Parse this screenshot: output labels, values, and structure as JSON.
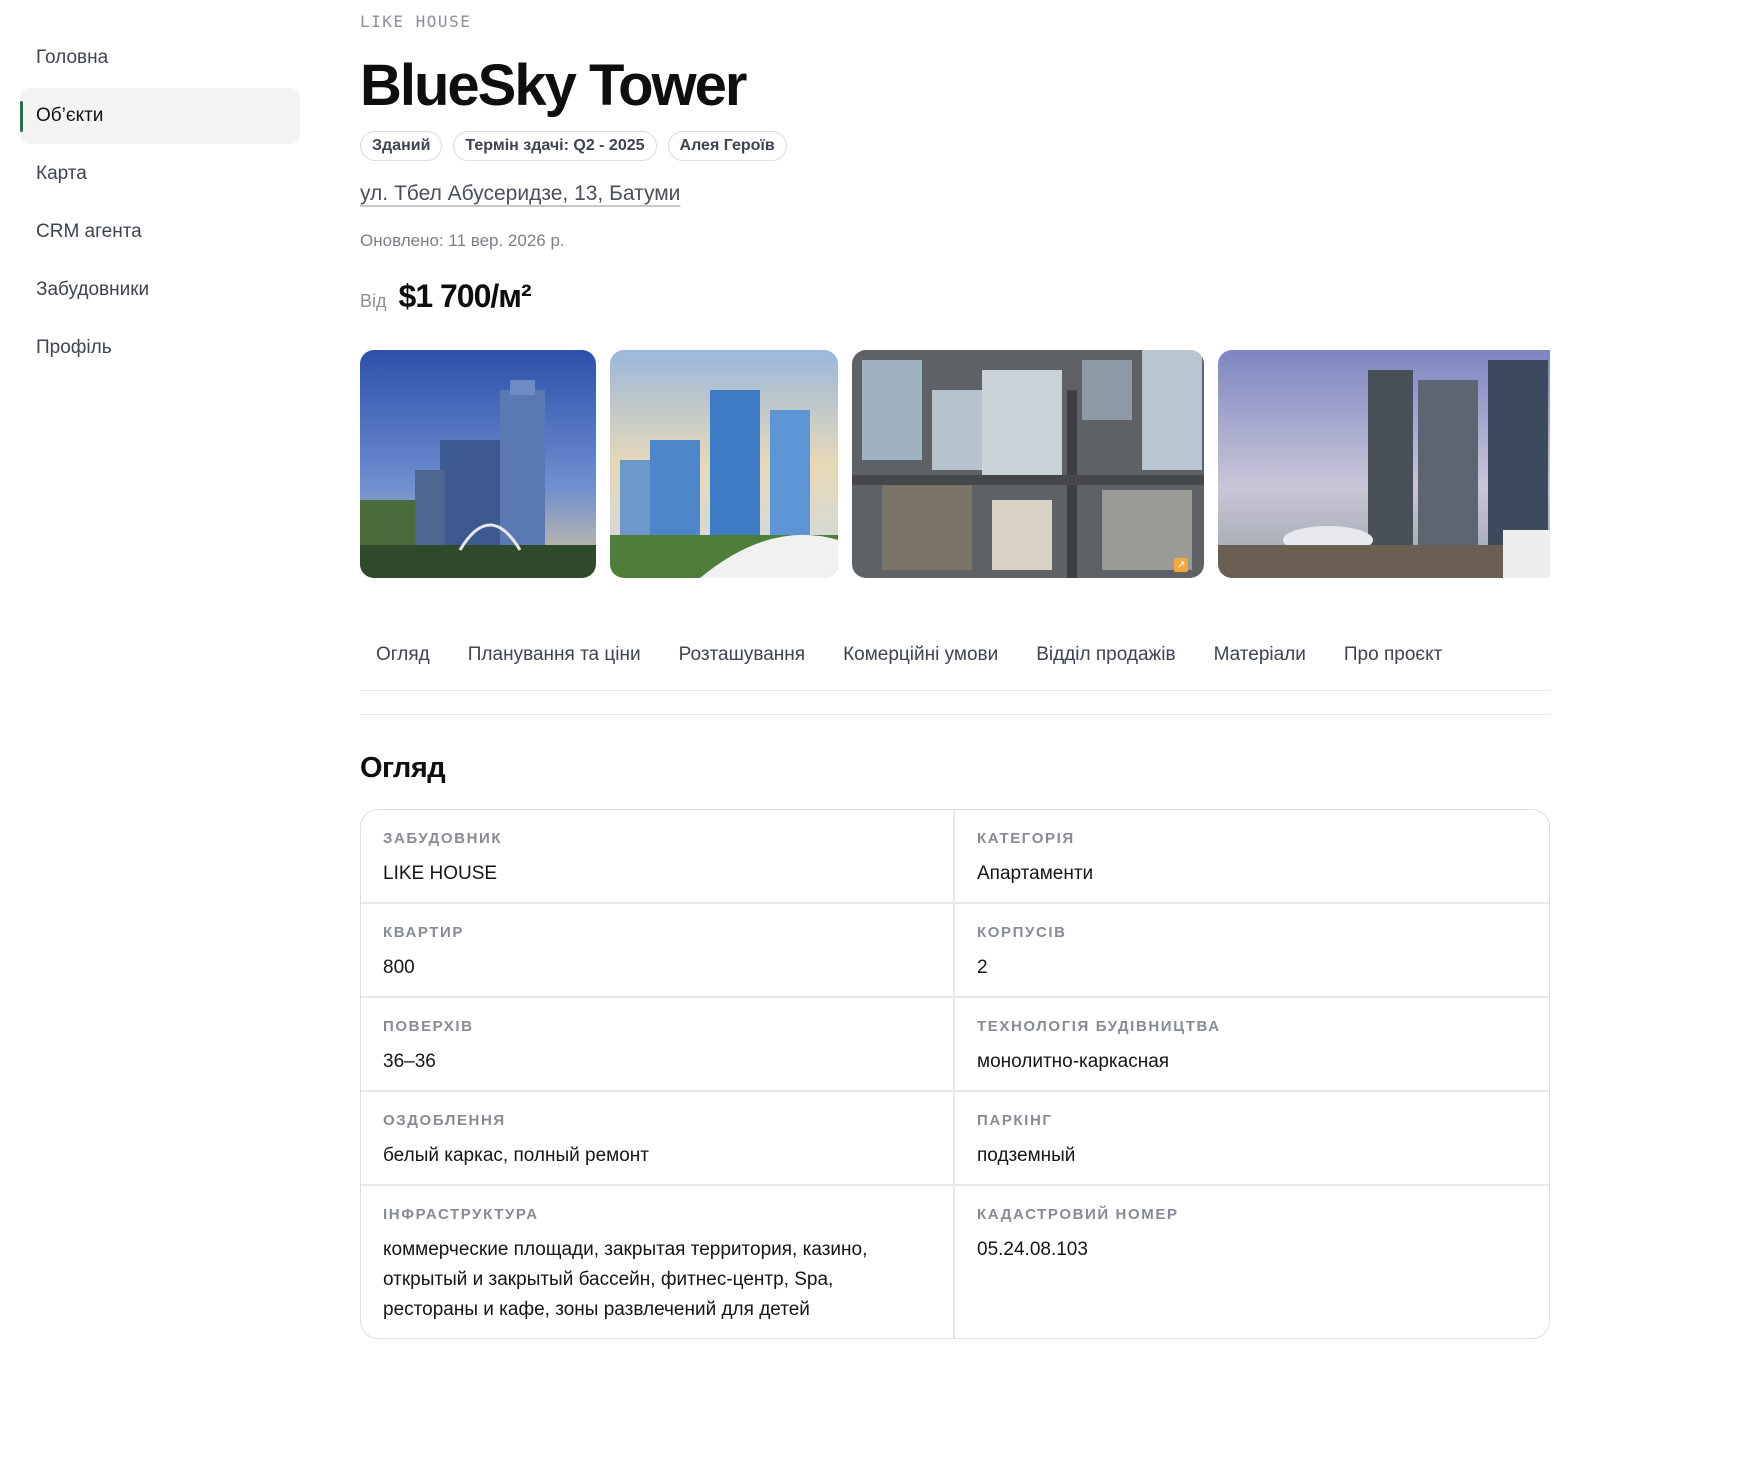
{
  "sidebar": {
    "items": [
      {
        "label": "Головна"
      },
      {
        "label": "Об’єкти",
        "active": true
      },
      {
        "label": "Карта"
      },
      {
        "label": "CRM агента"
      },
      {
        "label": "Забудовники"
      },
      {
        "label": "Профіль"
      }
    ]
  },
  "header": {
    "developer": "LIKE HOUSE",
    "title": "BlueSky Tower",
    "chips": [
      "Зданий",
      "Термін здачі: Q2 - 2025",
      "Алея Героїв"
    ],
    "address": "ул. Тбел Абусеридзе, 13, Батуми",
    "updated": "Оновлено: 11 вер. 2026 р.",
    "price_prefix": "Від",
    "price": "$1 700/м²"
  },
  "gallery": {
    "photos": [
      "tower-render-photo",
      "tower-coast-render-photo",
      "aerial-construction-photo",
      "city-towers-render-photo"
    ],
    "expand_icon": "expand-arrow-icon"
  },
  "tabs": [
    "Огляд",
    "Планування та ціни",
    "Розташування",
    "Комерційні умови",
    "Відділ продажів",
    "Матеріали",
    "Про проєкт"
  ],
  "overview": {
    "title": "Огляд",
    "specs": [
      {
        "label": "Забудовник",
        "value": "LIKE HOUSE"
      },
      {
        "label": "Категорія",
        "value": "Апартаменти"
      },
      {
        "label": "Квартир",
        "value": "800"
      },
      {
        "label": "Корпусів",
        "value": "2"
      },
      {
        "label": "Поверхів",
        "value": "36–36"
      },
      {
        "label": "Технологія будівництва",
        "value": "монолитно-каркасная"
      },
      {
        "label": "Оздоблення",
        "value": "белый каркас, полный ремонт"
      },
      {
        "label": "Паркінг",
        "value": "подземный"
      },
      {
        "label": "Інфраструктура",
        "value": "коммерческие площади, закрытая территория, казино, открытый и закрытый бассейн, фитнес-центр, Spa, рестораны и кафе, зоны развлечений для детей"
      },
      {
        "label": "Кадастровий номер",
        "value": "05.24.08.103"
      }
    ]
  },
  "colors": {
    "accent": "#2f6b4a",
    "nav_active_bg": "#f3f3f2",
    "muted": "#868b94"
  }
}
